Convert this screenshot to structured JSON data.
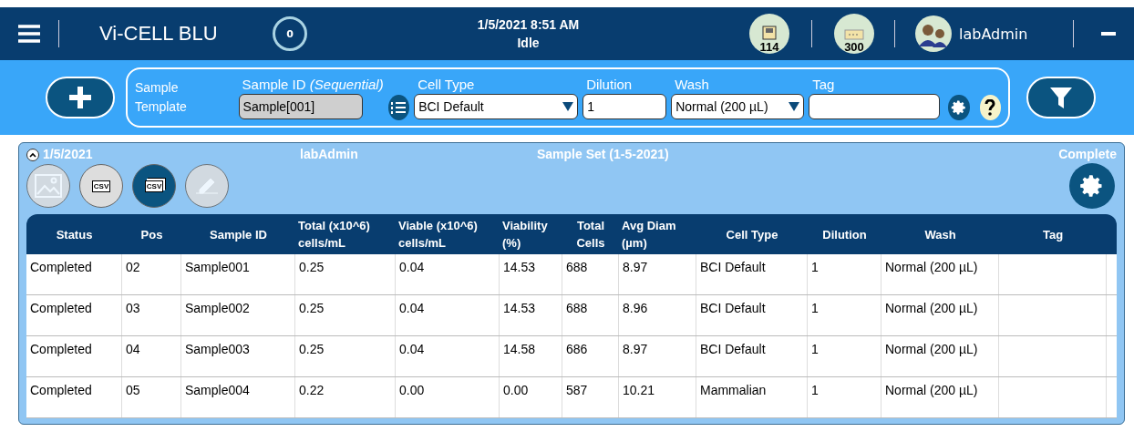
{
  "header": {
    "title": "Vi-CELL BLU",
    "queue_count": "0",
    "datetime": "1/5/2021 8:51 AM",
    "status": "Idle",
    "reagent_count": "114",
    "disposal_count": "300",
    "user": "labAdmin"
  },
  "template": {
    "label": "Sample Template",
    "sample_id": {
      "label": "Sample ID",
      "label_note": "(Sequential)",
      "value": "Sample[001]"
    },
    "cell_type": {
      "label": "Cell Type",
      "value": "BCI Default"
    },
    "dilution": {
      "label": "Dilution",
      "value": "1"
    },
    "wash": {
      "label": "Wash",
      "value": "Normal (200 µL)"
    },
    "tag": {
      "label": "Tag"
    }
  },
  "sample_set": {
    "expanded": true,
    "date": "1/5/2021",
    "user": "labAdmin",
    "name": "Sample Set (1-5-2021)",
    "status": "Complete",
    "actions": [
      {
        "kind": "image",
        "disabled": true,
        "highlighted": false
      },
      {
        "kind": "csv",
        "label": "CSV",
        "disabled": false,
        "highlighted": false
      },
      {
        "kind": "csv_multi",
        "label": "CSV",
        "disabled": false,
        "highlighted": true
      },
      {
        "kind": "sign",
        "disabled": true,
        "highlighted": false
      }
    ]
  },
  "table": {
    "columns": [
      "Status",
      "Pos",
      "Sample ID",
      "Total (x10^6) cells/mL",
      "Viable (x10^6) cells/mL",
      "Viability (%)",
      "Total Cells",
      "Avg Diam (µm)",
      "Cell Type",
      "Dilution",
      "Wash",
      "Tag"
    ],
    "rows": [
      [
        "Completed",
        "02",
        "Sample001",
        "0.25",
        "0.04",
        "14.53",
        "688",
        "8.97",
        "BCI Default",
        "1",
        "Normal (200 µL)",
        ""
      ],
      [
        "Completed",
        "03",
        "Sample002",
        "0.25",
        "0.04",
        "14.53",
        "688",
        "8.96",
        "BCI Default",
        "1",
        "Normal (200 µL)",
        ""
      ],
      [
        "Completed",
        "04",
        "Sample003",
        "0.25",
        "0.04",
        "14.58",
        "686",
        "8.97",
        "BCI Default",
        "1",
        "Normal (200 µL)",
        ""
      ],
      [
        "Completed",
        "05",
        "Sample004",
        "0.22",
        "0.00",
        "0.00",
        "587",
        "10.21",
        "Mammalian",
        "1",
        "Normal (200 µL)",
        ""
      ]
    ]
  }
}
